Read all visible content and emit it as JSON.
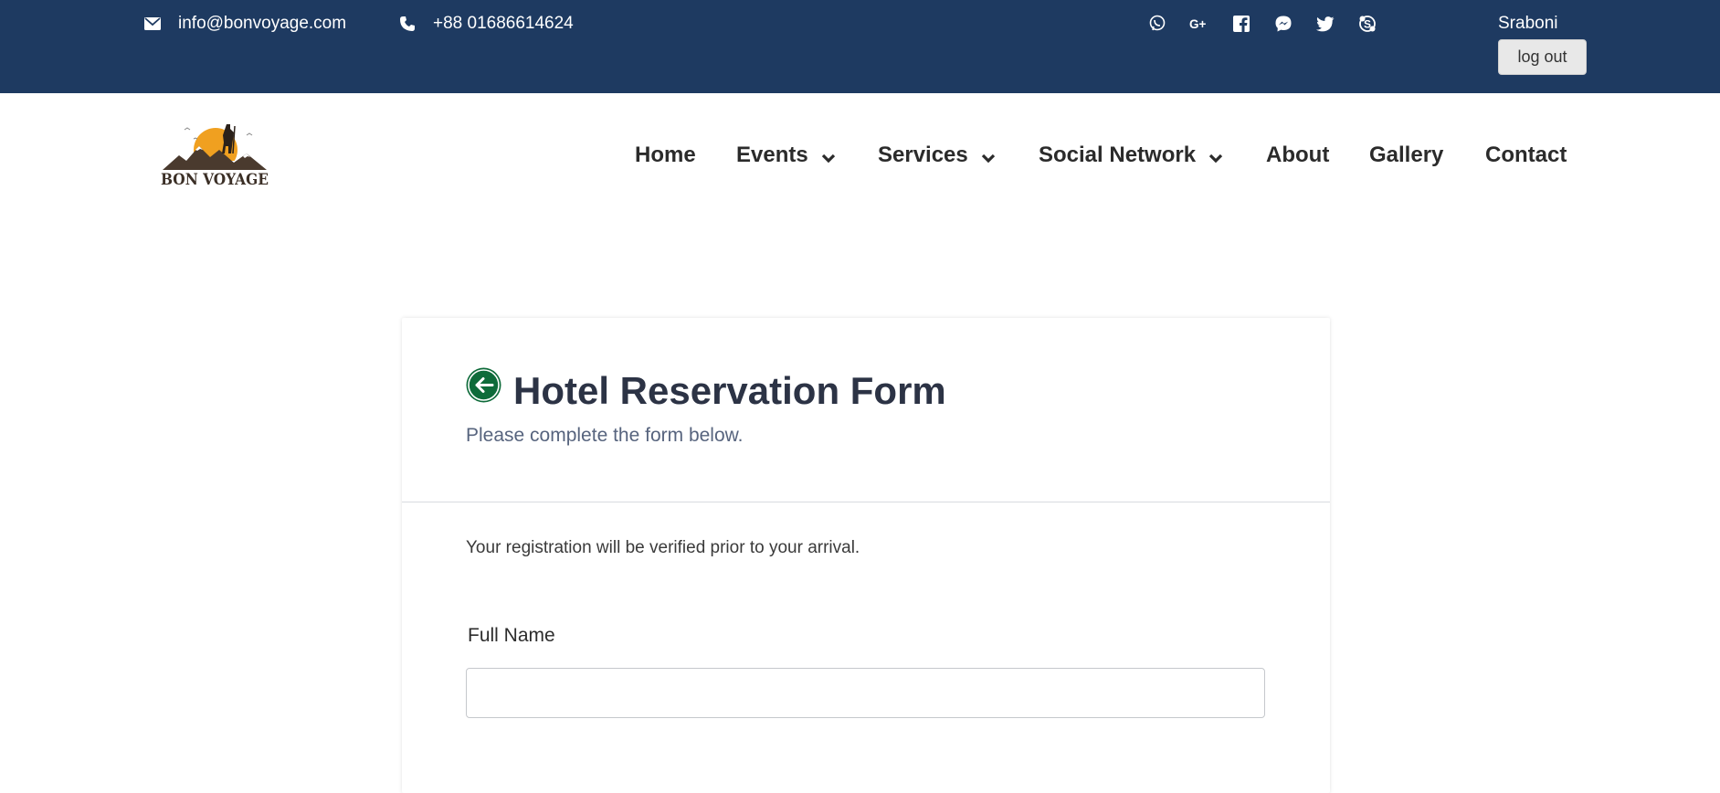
{
  "topbar": {
    "email": "info@bonvoyage.com",
    "phone": "+88 01686614624",
    "social_icons": [
      "viber-icon",
      "google-plus-icon",
      "facebook-icon",
      "messenger-icon",
      "twitter-icon",
      "skype-icon"
    ],
    "user_name": "Sraboni",
    "logout_label": "log out"
  },
  "brand": {
    "logo_text": "BON VOYAGE"
  },
  "nav": {
    "items": [
      {
        "label": "Home",
        "dropdown": false
      },
      {
        "label": "Events",
        "dropdown": true
      },
      {
        "label": "Services",
        "dropdown": true
      },
      {
        "label": "Social Network",
        "dropdown": true
      },
      {
        "label": "About",
        "dropdown": false
      },
      {
        "label": "Gallery",
        "dropdown": false
      },
      {
        "label": "Contact",
        "dropdown": false
      }
    ]
  },
  "form": {
    "title": "Hotel Reservation Form",
    "subtitle": "Please complete the form below.",
    "note": "Your registration will be verified prior to your arrival.",
    "full_name_label": "Full Name",
    "full_name_value": ""
  },
  "colors": {
    "topbar_bg": "#1e3a61",
    "back_button": "#0e6b3a",
    "title_text": "#2c3345",
    "subtitle_text": "#57647e",
    "logo_sun": "#f0a020"
  }
}
